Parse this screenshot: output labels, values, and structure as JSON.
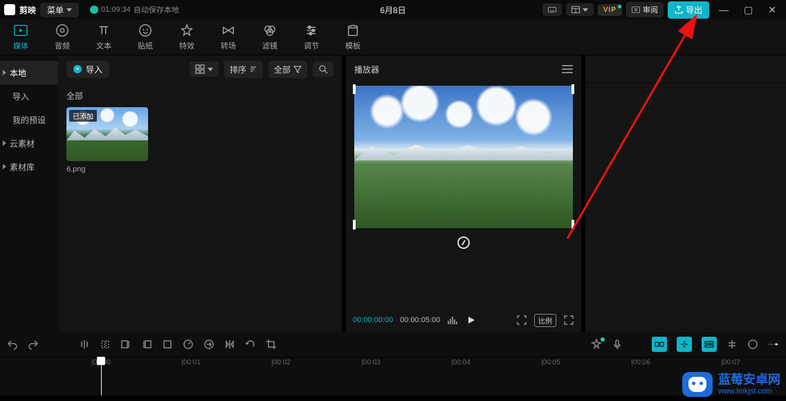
{
  "titlebar": {
    "app_name": "剪映",
    "menu_label": "菜单",
    "autosave_time": "01:09:34",
    "autosave_text": "自动保存本地",
    "project_title": "6月8日",
    "review_label": "审阅",
    "export_label": "导出"
  },
  "tabs": [
    {
      "id": "media",
      "label": "媒体",
      "active": true
    },
    {
      "id": "audio",
      "label": "音频"
    },
    {
      "id": "text",
      "label": "文本"
    },
    {
      "id": "sticker",
      "label": "贴纸"
    },
    {
      "id": "effect",
      "label": "特效"
    },
    {
      "id": "transition",
      "label": "转场"
    },
    {
      "id": "filter",
      "label": "滤镜"
    },
    {
      "id": "adjust",
      "label": "调节"
    },
    {
      "id": "template",
      "label": "模板"
    }
  ],
  "sidebar": {
    "items": [
      {
        "label": "本地",
        "node": true,
        "sel": true
      },
      {
        "label": "导入",
        "sub": true
      },
      {
        "label": "我的预设",
        "sub": true
      },
      {
        "label": "云素材",
        "node": true
      },
      {
        "label": "素材库",
        "node": true
      }
    ]
  },
  "media": {
    "import_label": "导入",
    "sort_label": "排序",
    "filter_label": "全部",
    "group_label": "全部",
    "items": [
      {
        "name": "6.png",
        "badge": "已添加"
      }
    ]
  },
  "player": {
    "title": "播放器",
    "current": "00:00:00:00",
    "duration": "00:00:05:00",
    "ratio_label": "比例"
  },
  "timeline": {
    "ticks": [
      "|00:00",
      "|00:01",
      "|00:02",
      "|00:03",
      "|00:04",
      "|00:05",
      "|00:06",
      "|00:07"
    ]
  },
  "watermark": {
    "line1": "蓝莓安卓网",
    "line2": "www.lmkjst.com"
  }
}
